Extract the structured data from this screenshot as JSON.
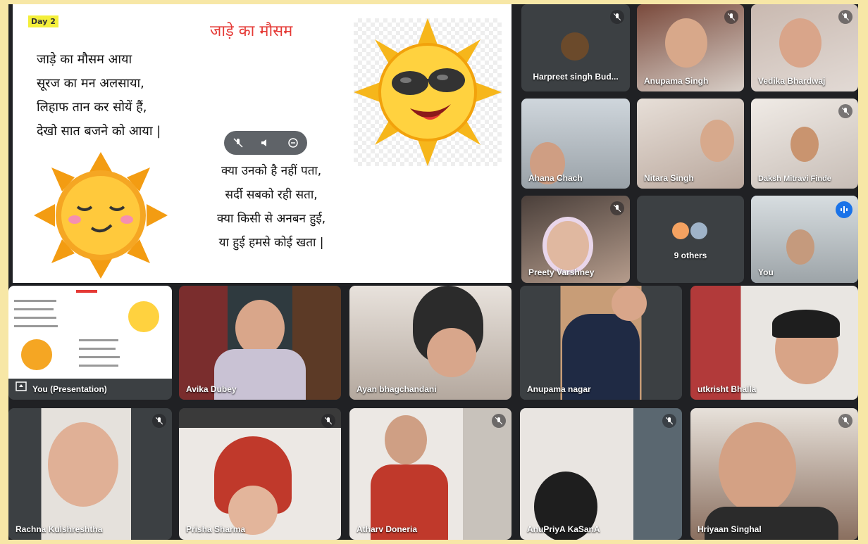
{
  "slide": {
    "day_label": "Day 2",
    "title": "जाड़े का मौसम",
    "poem_left": [
      "जाड़े का मौसम आया",
      "सूरज का मन अलसाया,",
      "लिहाफ तान कर सोयें हैं,",
      "देखो सात बजने को आया |"
    ],
    "poem_right": [
      "क्या उनको है नहीं पता,",
      "सर्दी सबको रही सता,",
      "क्या किसी से अनबन हुई,",
      "या हुई हमसे कोई खता |"
    ]
  },
  "presentation_controls": {
    "icons": [
      "mic-off-icon",
      "volume-icon",
      "remove-icon"
    ]
  },
  "participants": {
    "harpreet": "Harpreet singh Bud...",
    "anupama_singh": "Anupama Singh",
    "vedika": "Vedika Bhardwaj",
    "ahana": "Ahana Chach",
    "nitara": "Nitara Singh",
    "daksh": "Daksh Mitravi Finde",
    "preety": "Preety Varshney",
    "others": "9 others",
    "you": "You",
    "you_presentation": "You (Presentation)",
    "avika": "Avika Dubey",
    "ayan": "Ayan bhagchandani",
    "anupama_nagar": "Anupama nagar",
    "utkrisht": "utkrisht Bhalla",
    "rachna": "Rachna Kulshreshtha",
    "prisha": "Prisha Sharma",
    "atharv": "Atharv Doneria",
    "anupriya": "AnuPriyA KaSanA",
    "hriyaan": "Hriyaan Singhal"
  },
  "colors": {
    "meet_bg": "#202124",
    "tile_bg": "#3c4043",
    "accent": "#1a73e8",
    "title_red": "#e53935"
  }
}
